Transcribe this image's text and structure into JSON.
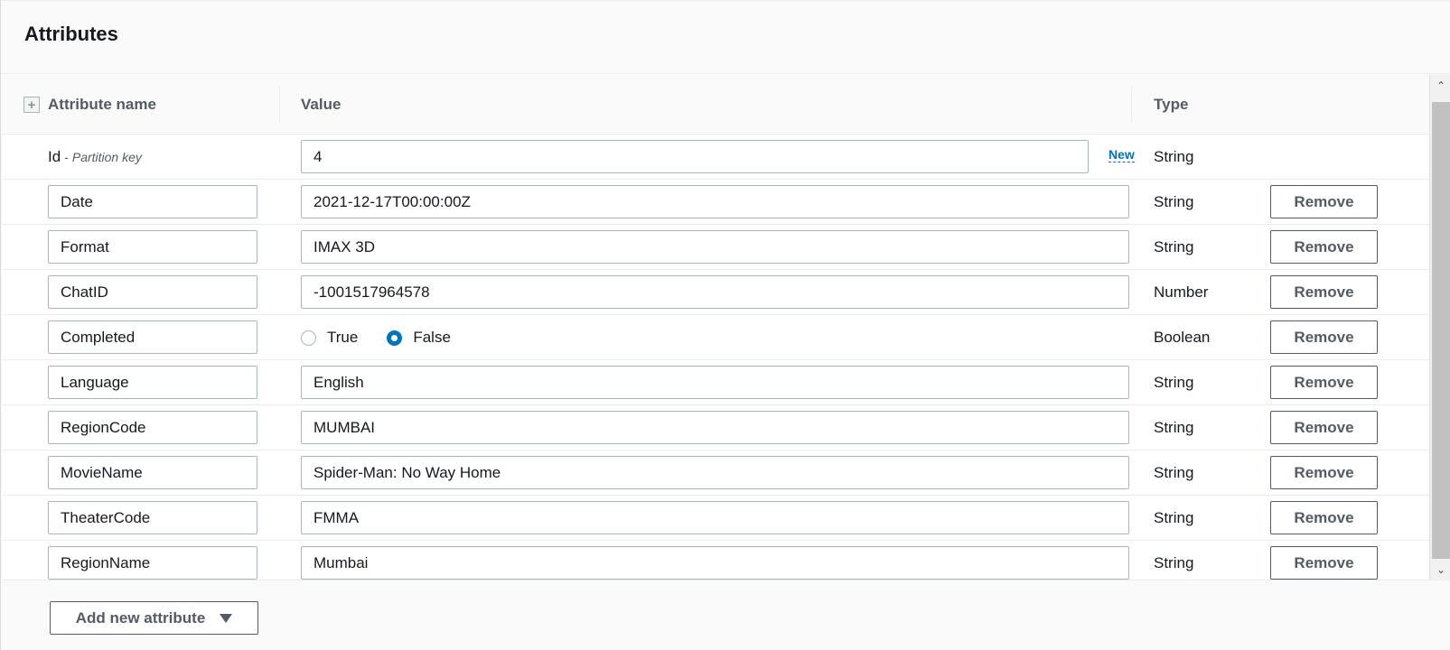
{
  "panel": {
    "title": "Attributes"
  },
  "table": {
    "headers": {
      "name": "Attribute name",
      "value": "Value",
      "type": "Type"
    },
    "expand_icon": "plus-square-icon",
    "key_row": {
      "name": "Id",
      "separator": "-",
      "note": "Partition key",
      "value": "4",
      "new_label": "New",
      "type": "String"
    },
    "rows": [
      {
        "name": "Date",
        "value": "2021-12-17T00:00:00Z",
        "type": "String",
        "remove": "Remove"
      },
      {
        "name": "Format",
        "value": "IMAX 3D",
        "type": "String",
        "remove": "Remove"
      },
      {
        "name": "ChatID",
        "value": "-1001517964578",
        "type": "Number",
        "remove": "Remove"
      },
      {
        "name": "Completed",
        "type": "Boolean",
        "remove": "Remove",
        "boolean": {
          "options": [
            "True",
            "False"
          ],
          "selected": "False"
        }
      },
      {
        "name": "Language",
        "value": "English",
        "type": "String",
        "remove": "Remove"
      },
      {
        "name": "RegionCode",
        "value": "MUMBAI",
        "type": "String",
        "remove": "Remove"
      },
      {
        "name": "MovieName",
        "value": "Spider-Man: No Way Home",
        "type": "String",
        "remove": "Remove"
      },
      {
        "name": "TheaterCode",
        "value": "FMMA",
        "type": "String",
        "remove": "Remove"
      },
      {
        "name": "RegionName",
        "value": "Mumbai",
        "type": "String",
        "remove": "Remove"
      }
    ]
  },
  "footer": {
    "add_button_label": "Add new attribute",
    "add_button_icon": "caret-down-icon"
  },
  "colors": {
    "accent": "#0073bb",
    "text": "#16191f",
    "muted_text": "#545b64",
    "border": "#aab7b8",
    "background": "#fafafa"
  }
}
